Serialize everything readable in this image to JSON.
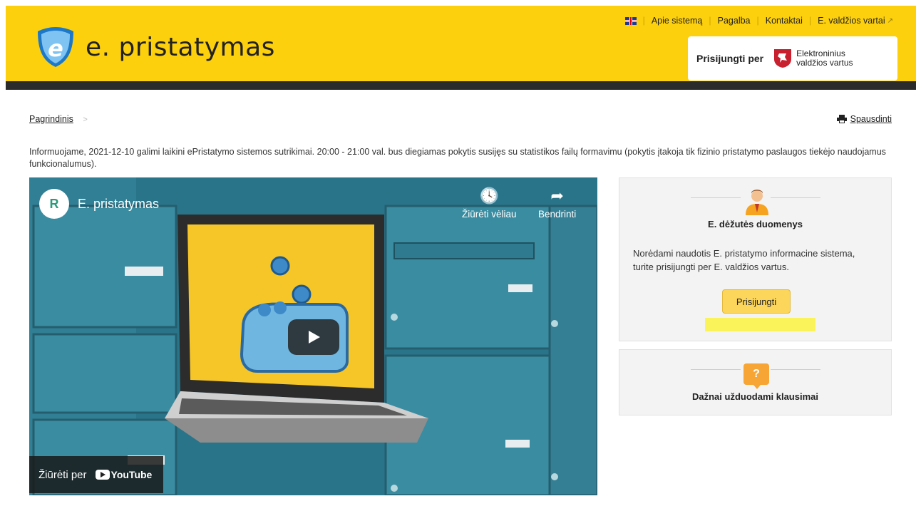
{
  "header": {
    "logo_text": "e. pristatymas",
    "nav": [
      "Apie sistemą",
      "Pagalba",
      "Kontaktai",
      "E. valdžios vartai"
    ],
    "login_label": "Prisijungti per",
    "gateway_line1": "Elektroninius",
    "gateway_line2": "valdžios vartus"
  },
  "breadcrumb": {
    "home": "Pagrindinis"
  },
  "print_label": "Spausdinti",
  "notice": "Informuojame, 2021-12-10 galimi laikini ePristatymo sistemos sutrikimai. 20:00 - 21:00 val. bus diegiamas pokytis susijęs su statistikos failų formavimu (pokytis įtakoja tik fizinio pristatymo paslaugos tiekėjo naudojamus funkcionalumus).",
  "video": {
    "channel": "E. pristatymas",
    "watch_later": "Žiūrėti vėliau",
    "share": "Bendrinti",
    "watch_on": "Žiūrėti per",
    "youtube": "YouTube"
  },
  "mailbox_card": {
    "title": "E. dėžutės duomenys",
    "text": "Norėdami naudotis E. pristatymo informacine sistema, turite prisijungti per E. valdžios vartus.",
    "button": "Prisijungti"
  },
  "faq_card": {
    "title": "Dažnai užduodami klausimai"
  },
  "colors": {
    "brand_yellow": "#fdd00d",
    "dark_bar": "#2b2b2b",
    "video_teal": "#2f7f93",
    "button_yellow": "#fcd65a"
  }
}
